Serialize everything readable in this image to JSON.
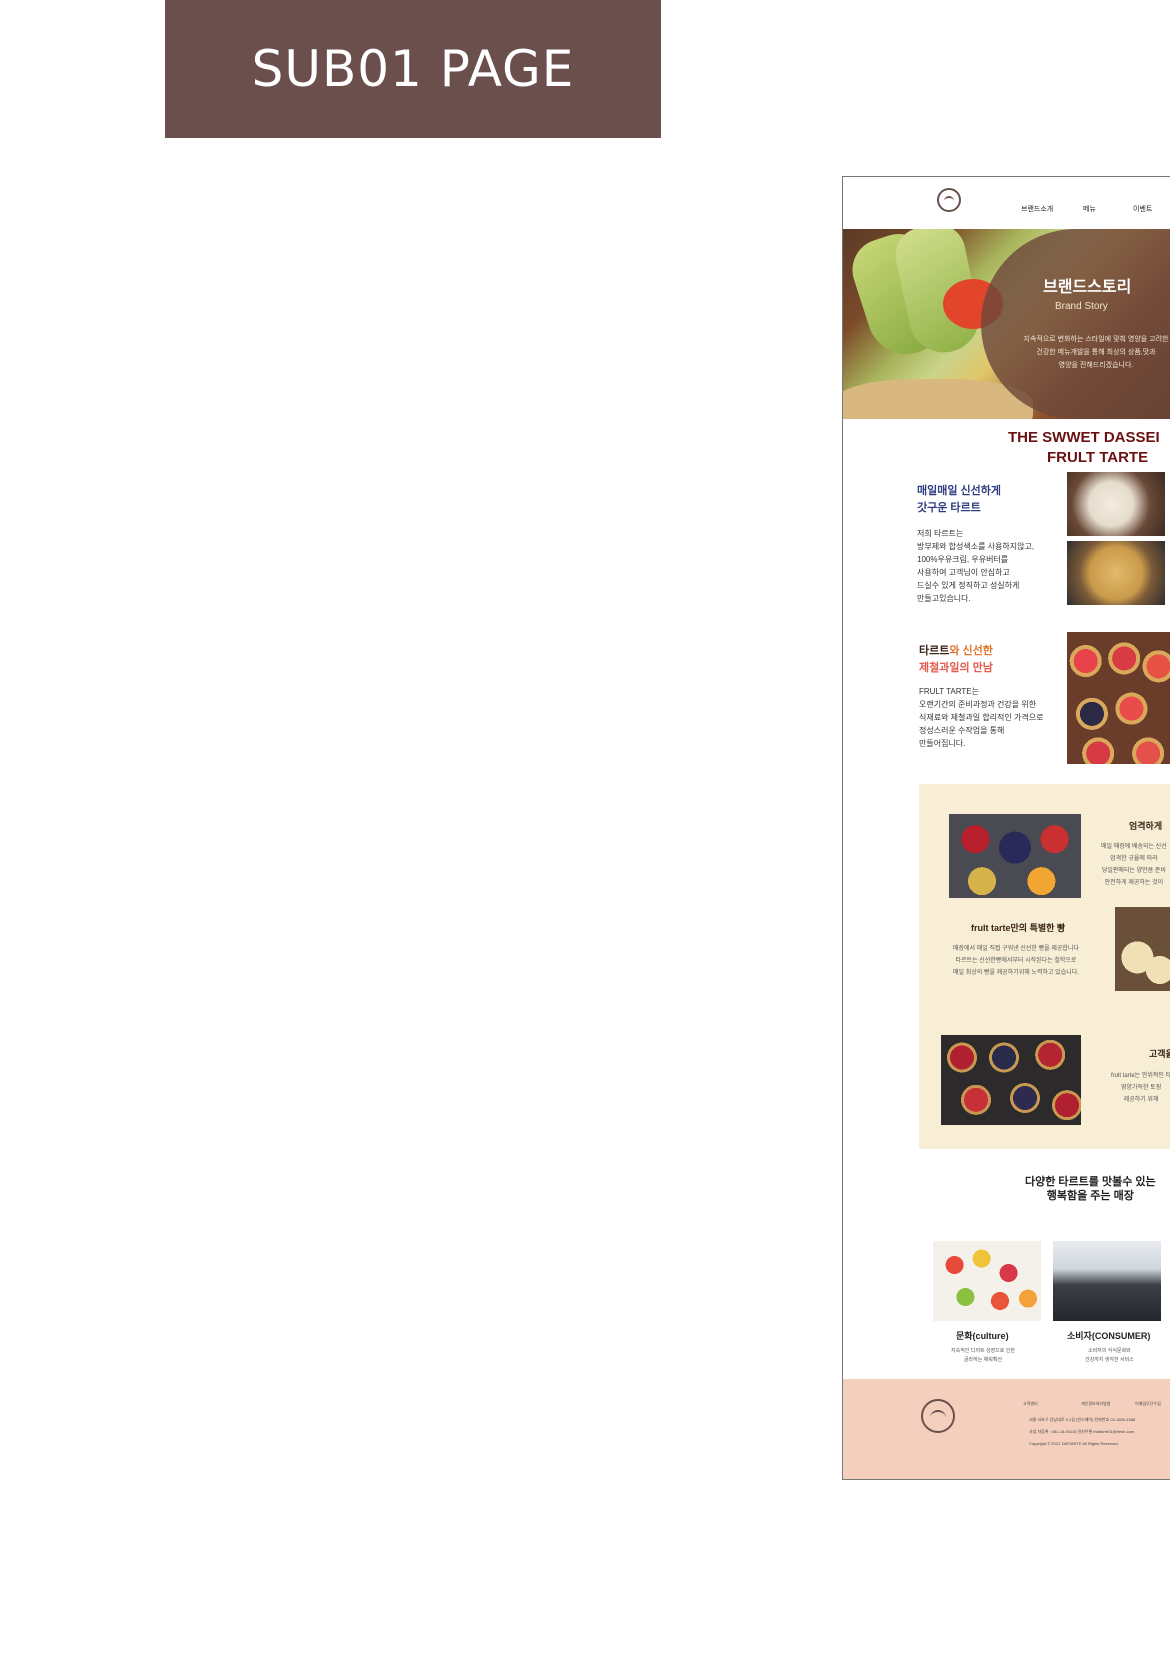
{
  "banner": {
    "title": "SUB01 PAGE"
  },
  "header": {
    "nav": [
      "브랜드소개",
      "메뉴",
      "이벤트"
    ]
  },
  "hero": {
    "title": "브랜드스토리",
    "subtitle": "Brand Story",
    "description": [
      "지속적으로 변화하는 스타일에 맞춰 영양을 고려한",
      "건강한 메뉴개발을 통해 최상의 상품,맛과",
      "영양을 전해드리겠습니다."
    ]
  },
  "headline": {
    "line1": "THE SWWET DASSEI",
    "line2": "FRULT TARTE"
  },
  "section1": {
    "title": [
      "매일매일 신선하게",
      "갓구운 타르트"
    ],
    "body": [
      "저희 타르트는",
      "방부제와 합성색소를 사용하지않고,",
      "100%우유크림, 우유버터를",
      "사용하여 고객님이 안심하고",
      "드실수 있게 정직하고 성실하게",
      "만들고있습니다."
    ]
  },
  "section2": {
    "title_part1": "타르트",
    "title_part2": "와 신선한",
    "title_line2": "제철과일의 만남",
    "body": [
      "FRULT TARTE는",
      "오랜기간의 준비과정과 건강을 위한",
      "식재료와 제철과일 합리적인 가격으로",
      "정성스러운 수작업을 통해",
      "만들어집니다."
    ]
  },
  "cream": {
    "block1": {
      "title": "엄격하게",
      "body": [
        "매일 매장에 배송되는 신선",
        "엄격한 규율에 따라",
        "당일판매되는 양만큼 준비",
        "안전하게 제공하는 것이"
      ]
    },
    "block2": {
      "title": "frult tarte만의 특별한 빵",
      "body": [
        "매장에서 매일 직접 구워낸 신선한 빵을 제공합니다",
        "타르트는 신선한빵에서부터 시작된다는 철학으로",
        "매일 최상의 빵을 제공하기위해 노력하고 있습니다."
      ]
    },
    "block3": {
      "title": "고객을",
      "body": [
        "frult tarte는 안위적인 타",
        "영양가득한 토핑",
        "제공하기 위해"
      ]
    }
  },
  "stores": {
    "title": [
      "다양한 타르트를 맛볼수 있는",
      "행복함을 주는 매장"
    ],
    "items": [
      {
        "caption": "문화(culture)",
        "desc": [
          "지속적인 디저트 성장으로 인한",
          "글라하는 채워확산"
        ]
      },
      {
        "caption": "소비자(CONSUMER)",
        "desc": [
          "소비자의 식식문화와",
          "건강까지 생각한 서비스"
        ]
      }
    ]
  },
  "footer": {
    "cols": [
      "고객센터",
      "개인정보처리방침",
      "이메일무단수집"
    ],
    "lines": [
      "서울 서초구 강남대로 9-1길 (빈스퀘어)   전화번호 02-1800-1588",
      "사업 자등록 : 081-16-00115   전자우편 frulttarte01@fresh.com",
      "Copyright © 2021 TARTARTE All Rights Reserved."
    ]
  }
}
